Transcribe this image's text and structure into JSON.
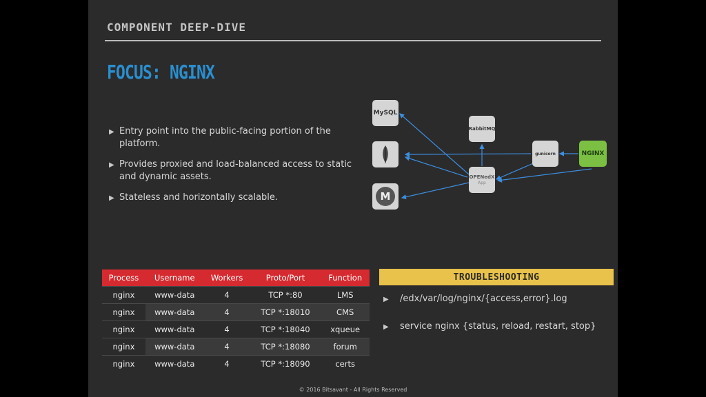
{
  "header": {
    "section_title": "COMPONENT DEEP-DIVE",
    "title": "FOCUS: NGINX"
  },
  "bullets": [
    "Entry point into the public-facing portion of the platform.",
    "Provides proxied and load-balanced access to static and dynamic assets.",
    "Stateless and horizontally scalable."
  ],
  "diagram": {
    "nodes": {
      "mysql": "MySQL",
      "mongodb": "mongodb-icon",
      "memcached": "M",
      "rabbitmq": "RabbitMQ",
      "openedx": "OPENedX",
      "openedx_sub": "App",
      "gunicorn": "gunicorn",
      "nginx": "NGINX"
    }
  },
  "table": {
    "headers": [
      "Process",
      "Username",
      "Workers",
      "Proto/Port",
      "Function"
    ],
    "rows": [
      [
        "nginx",
        "www-data",
        "4",
        "TCP *:80",
        "LMS"
      ],
      [
        "nginx",
        "www-data",
        "4",
        "TCP *:18010",
        "CMS"
      ],
      [
        "nginx",
        "www-data",
        "4",
        "TCP *:18040",
        "xqueue"
      ],
      [
        "nginx",
        "www-data",
        "4",
        "TCP *:18080",
        "forum"
      ],
      [
        "nginx",
        "www-data",
        "4",
        "TCP *:18090",
        "certs"
      ]
    ]
  },
  "troubleshooting": {
    "title": "TROUBLESHOOTING",
    "items": [
      "/edx/var/log/nginx/{access,error}.log",
      "service nginx {status, reload, restart, stop}"
    ]
  },
  "footer": "© 2016 Bitsavant - All Rights Reserved",
  "colors": {
    "accent_blue": "#2a8fd0",
    "header_red": "#d52a2f",
    "trouble_yellow": "#e8c24a",
    "nginx_green": "#7bc043",
    "arrow_blue": "#3d8ee0"
  }
}
